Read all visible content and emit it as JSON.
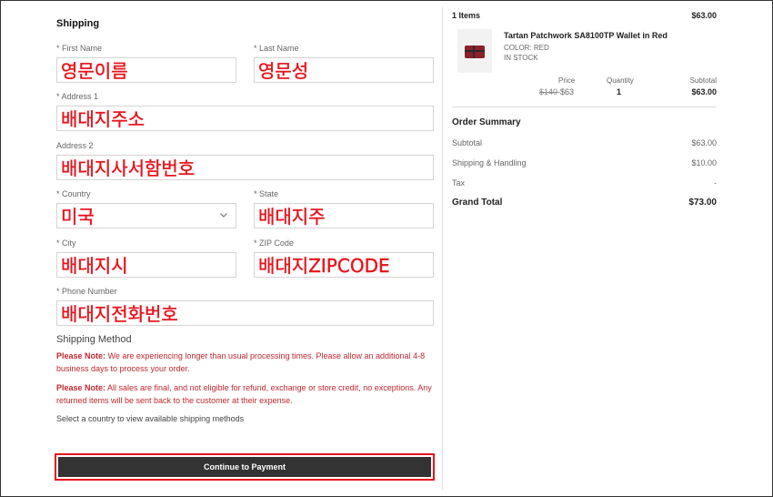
{
  "shipping": {
    "title": "Shipping",
    "first_name": {
      "label": "* First Name",
      "value": "영문이름"
    },
    "last_name": {
      "label": "* Last Name",
      "value": "영문성"
    },
    "address1": {
      "label": "* Address 1",
      "value": "배대지주소"
    },
    "address2": {
      "label": "Address 2",
      "value": "배대지사서함번호"
    },
    "country": {
      "label": "* Country",
      "value": "미국"
    },
    "state": {
      "label": "* State",
      "value": "배대지주"
    },
    "city": {
      "label": "* City",
      "value": "배대지시"
    },
    "zip": {
      "label": "* ZIP Code",
      "value": "배대지ZIPCODE"
    },
    "phone": {
      "label": "* Phone Number",
      "value": "배대지전화번호"
    },
    "method_title": "Shipping Method",
    "note1_label": "Please Note:",
    "note1_text": " We are experiencing longer than usual processing times. Please allow an additional 4-8 business days to process your order.",
    "note2_label": "Please Note:",
    "note2_text": " All sales are final, and not eligible for refund, exchange or store credit, no exceptions. Any returned items will be sent back to the customer at their expense.",
    "select_msg": "Select a country to view available shipping methods",
    "continue_label": "Continue to Payment"
  },
  "cart": {
    "items_count": "1 Items",
    "items_total": "$63.00",
    "product_name": "Tartan Patchwork SA8100TP Wallet in Red",
    "color": "COLOR: RED",
    "stock": "IN STOCK",
    "price_label": "Price",
    "qty_label": "Quantity",
    "subtotal_label": "Subtotal",
    "old_price": "$140",
    "new_price": "-$63",
    "quantity": "1",
    "line_subtotal": "$63.00"
  },
  "summary": {
    "title": "Order Summary",
    "subtotal_label": "Subtotal",
    "subtotal_value": "$63.00",
    "shipping_label": "Shipping & Handling",
    "shipping_value": "$10.00",
    "tax_label": "Tax",
    "tax_value": "-",
    "grand_label": "Grand Total",
    "grand_value": "$73.00"
  },
  "colors": {
    "annotation_red": "#e8141d",
    "note_red": "#c0282d",
    "button_bg": "#333333"
  },
  "icons": {
    "country_dropdown": "chevron-down-icon",
    "product_image": "wallet-thumbnail"
  }
}
